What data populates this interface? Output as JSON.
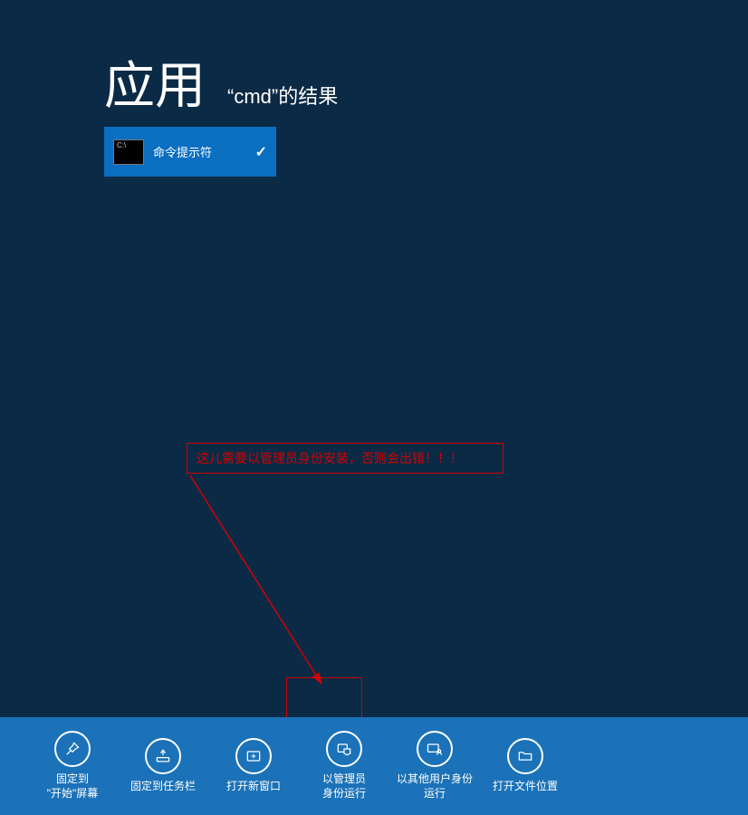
{
  "header": {
    "title": "应用",
    "subtitle": "“cmd”的结果"
  },
  "result": {
    "icon_text": "C:\\",
    "label": "命令提示符",
    "checked": "✓"
  },
  "annotation": {
    "text": "这儿需要以管理员身份安装，否则会出错！！！"
  },
  "actions": [
    {
      "id": "pin-start",
      "label": "固定到\n\"开始\"屏幕"
    },
    {
      "id": "pin-taskbar",
      "label": "固定到任务栏"
    },
    {
      "id": "new-window",
      "label": "打开新窗口"
    },
    {
      "id": "run-admin",
      "label": "以管理员\n身份运行"
    },
    {
      "id": "run-other-user",
      "label": "以其他用户身份\n运行"
    },
    {
      "id": "open-location",
      "label": "打开文件位置"
    }
  ]
}
